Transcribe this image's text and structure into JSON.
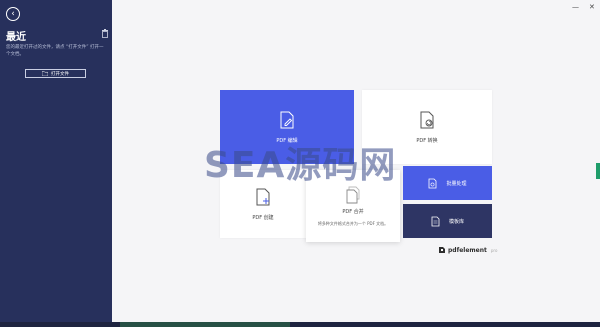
{
  "sidebar": {
    "title": "最近",
    "description": "您的最近打开过的文件，请点 “打开文件” 打开一个文档。",
    "open_file_label": "打开文件"
  },
  "window_controls": {
    "minimize": "—",
    "close": "✕"
  },
  "cards": {
    "edit": {
      "label": "PDF 编辑"
    },
    "convert": {
      "label": "PDF 转换"
    },
    "create": {
      "label": "PDF 创建"
    },
    "merge": {
      "label": "PDF 合并",
      "subtitle": "将多种文件格式合并为一个 PDF 文档。"
    },
    "batch": {
      "label": "批量处理"
    },
    "template": {
      "label": "模板库"
    }
  },
  "watermark": "SEA源码网",
  "brand": {
    "name": "pdfelement",
    "edition": "pro"
  },
  "colors": {
    "sidebar": "#27305c",
    "accent_blue": "#4a5de6",
    "navy": "#2e3564"
  }
}
